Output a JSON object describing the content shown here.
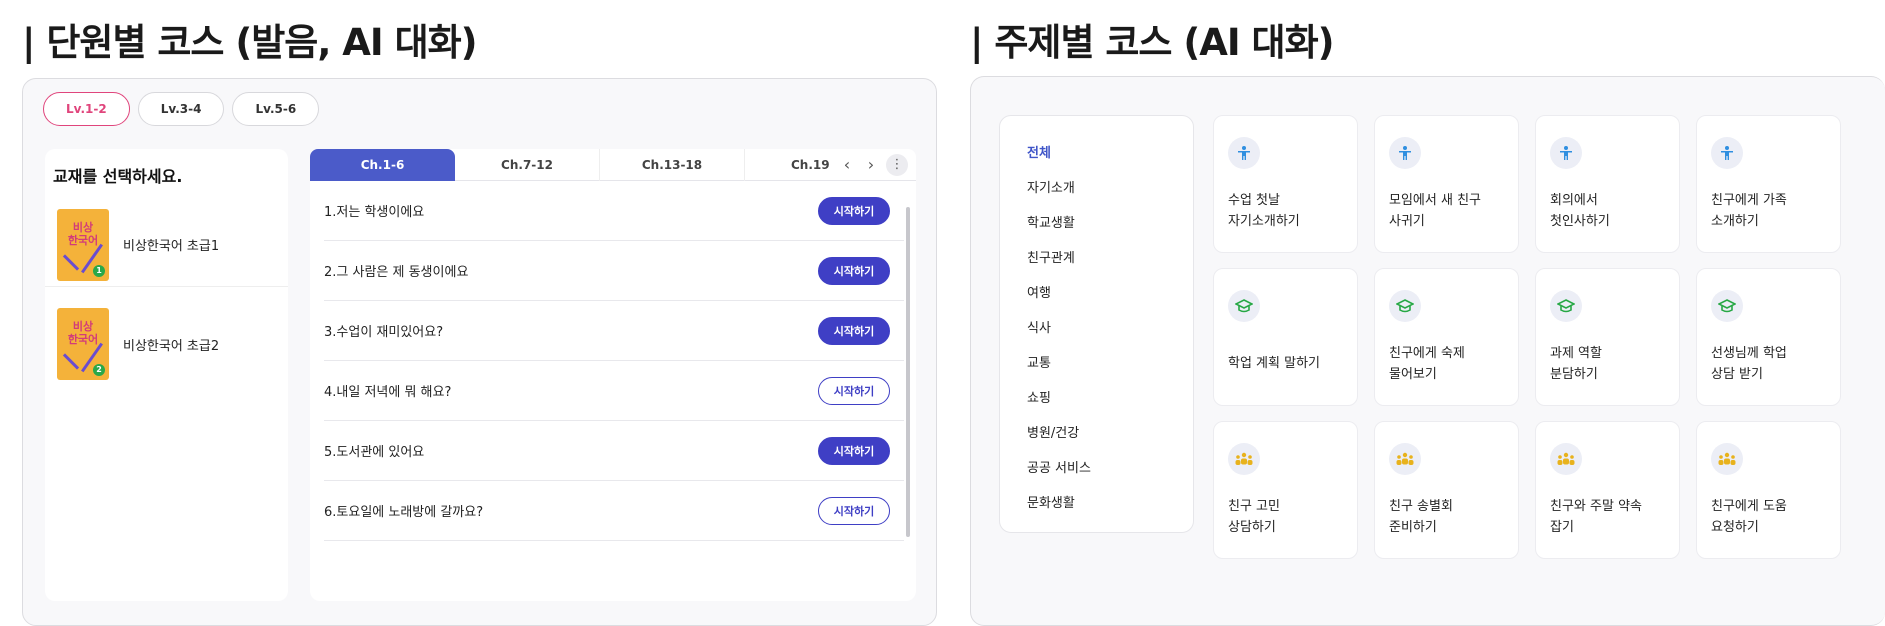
{
  "left_section": {
    "title": "| 단원별 코스 (발음, AI 대화)",
    "levels": [
      {
        "label": "Lv.1-2",
        "active": true
      },
      {
        "label": "Lv.3-4",
        "active": false
      },
      {
        "label": "Lv.5-6",
        "active": false
      }
    ],
    "book_heading": "교재를 선택하세요.",
    "cover_text": "비상\n한국어",
    "books": [
      {
        "name": "비상한국어 초급1"
      },
      {
        "name": "비상한국어 초급2"
      }
    ],
    "chapter_tabs": [
      "Ch.1-6",
      "Ch.7-12",
      "Ch.13-18",
      "Ch.19"
    ],
    "lessons": [
      {
        "title": "1.저는 학생이에요",
        "button": "시작하기",
        "style": "filled"
      },
      {
        "title": "2.그 사람은 제 동생이에요",
        "button": "시작하기",
        "style": "filled"
      },
      {
        "title": "3.수업이 재미있어요?",
        "button": "시작하기",
        "style": "filled"
      },
      {
        "title": "4.내일 저녁에 뭐 해요?",
        "button": "시작하기",
        "style": "outline"
      },
      {
        "title": "5.도서관에 있어요",
        "button": "시작하기",
        "style": "filled"
      },
      {
        "title": "6.토요일에 노래방에 갈까요?",
        "button": "시작하기",
        "style": "outline"
      }
    ]
  },
  "right_section": {
    "title": "| 주제별 코스 (AI 대화)",
    "categories": [
      "전체",
      "자기소개",
      "학교생활",
      "친구관계",
      "여행",
      "식사",
      "교통",
      "쇼핑",
      "병원/건강",
      "공공 서비스",
      "문화생활"
    ],
    "active_category": "전체",
    "cards": [
      {
        "line1": "수업 첫날",
        "line2": "자기소개하기",
        "icon": "person-icon",
        "color": "#2f8fe0"
      },
      {
        "line1": "모임에서 새 친구",
        "line2": "사귀기",
        "icon": "person-icon",
        "color": "#2f8fe0"
      },
      {
        "line1": "회의에서",
        "line2": "첫인사하기",
        "icon": "person-icon",
        "color": "#2f8fe0"
      },
      {
        "line1": "친구에게 가족",
        "line2": "소개하기",
        "icon": "person-icon",
        "color": "#2f8fe0"
      },
      {
        "line1": "학업 계획 말하기",
        "line2": "",
        "icon": "graduation-cap-icon",
        "color": "#27a845"
      },
      {
        "line1": "친구에게 숙제",
        "line2": "물어보기",
        "icon": "graduation-cap-icon",
        "color": "#27a845"
      },
      {
        "line1": "과제 역할",
        "line2": "분담하기",
        "icon": "graduation-cap-icon",
        "color": "#27a845"
      },
      {
        "line1": "선생님께 학업",
        "line2": "상담 받기",
        "icon": "graduation-cap-icon",
        "color": "#27a845"
      },
      {
        "line1": "친구 고민",
        "line2": "상담하기",
        "icon": "group-icon",
        "color": "#e8b21c"
      },
      {
        "line1": "친구 송별회",
        "line2": "준비하기",
        "icon": "group-icon",
        "color": "#e8b21c"
      },
      {
        "line1": "친구와 주말 약속",
        "line2": "잡기",
        "icon": "group-icon",
        "color": "#e8b21c"
      },
      {
        "line1": "친구에게 도움",
        "line2": "요청하기",
        "icon": "group-icon",
        "color": "#e8b21c"
      }
    ]
  }
}
